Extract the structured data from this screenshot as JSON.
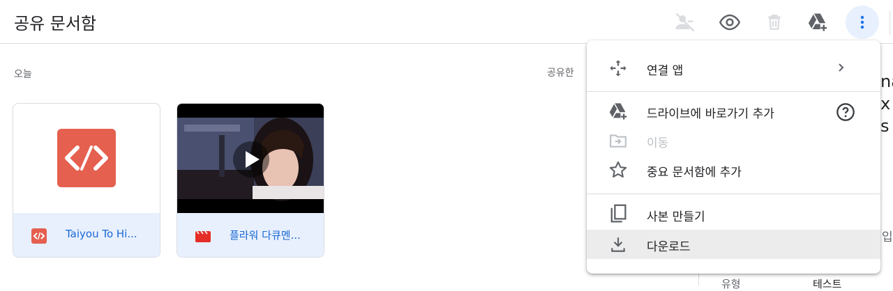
{
  "header": {
    "title": "공유 문서함",
    "icons": [
      "remove-person-icon",
      "eye-icon",
      "trash-icon",
      "add-to-drive-icon",
      "more-vert-icon"
    ]
  },
  "main": {
    "section_label": "오늘",
    "shared_label": "공유한",
    "files": [
      {
        "name": "Taiyou To Hi...",
        "type": "code"
      },
      {
        "name": "플라워 다큐멘...",
        "type": "video"
      }
    ]
  },
  "menu": {
    "items": [
      {
        "label": "연결 앱",
        "icon": "move-arrows-icon",
        "has_submenu": true
      },
      {
        "label": "드라이브에 바로가기 추가",
        "icon": "add-to-drive-icon",
        "help": true
      },
      {
        "label": "이동",
        "icon": "move-folder-icon",
        "disabled": true
      },
      {
        "label": "중요 문서함에 추가",
        "icon": "star-icon"
      },
      {
        "label": "사본 만들기",
        "icon": "copy-icon"
      },
      {
        "label": "다운로드",
        "icon": "download-icon",
        "hovered": true
      }
    ]
  },
  "right_panel_peek": {
    "lines": [
      "na",
      "x",
      "s"
    ],
    "side_text": "입",
    "bottom_left": "유형",
    "bottom_right": "테스트"
  },
  "colors": {
    "accent": "#1967d2",
    "card_footer": "#e8f0fe",
    "code_red": "#e5604f",
    "icon_gray": "#5f6368"
  }
}
